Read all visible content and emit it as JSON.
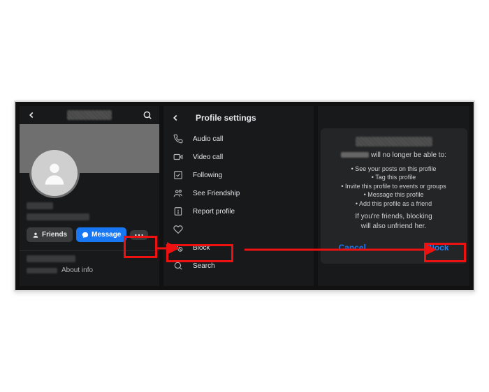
{
  "panel1": {
    "friends_label": "Friends",
    "message_label": "Message",
    "about_label": "About info"
  },
  "panel2": {
    "title": "Profile settings",
    "items": [
      {
        "icon": "phone-icon",
        "label": "Audio call"
      },
      {
        "icon": "video-icon",
        "label": "Video call"
      },
      {
        "icon": "check-square-icon",
        "label": "Following"
      },
      {
        "icon": "people-icon",
        "label": "See Friendship"
      },
      {
        "icon": "report-icon",
        "label": "Report profile"
      },
      {
        "icon": "heart-icon",
        "label": ""
      },
      {
        "icon": "block-icon",
        "label": "Block"
      },
      {
        "icon": "search-icon",
        "label": "Search"
      }
    ]
  },
  "panel3": {
    "sub_suffix": " will no longer be able to:",
    "bullets": [
      "See your posts on this profile",
      "Tag this profile",
      "Invite this profile to events or groups",
      "Message this profile",
      "Add this profile as a friend"
    ],
    "footer_prefix": "If you're friends, blocking ",
    "footer_suffix": "will also unfriend her.",
    "cancel_label": "Cancel",
    "block_label": "Block"
  }
}
